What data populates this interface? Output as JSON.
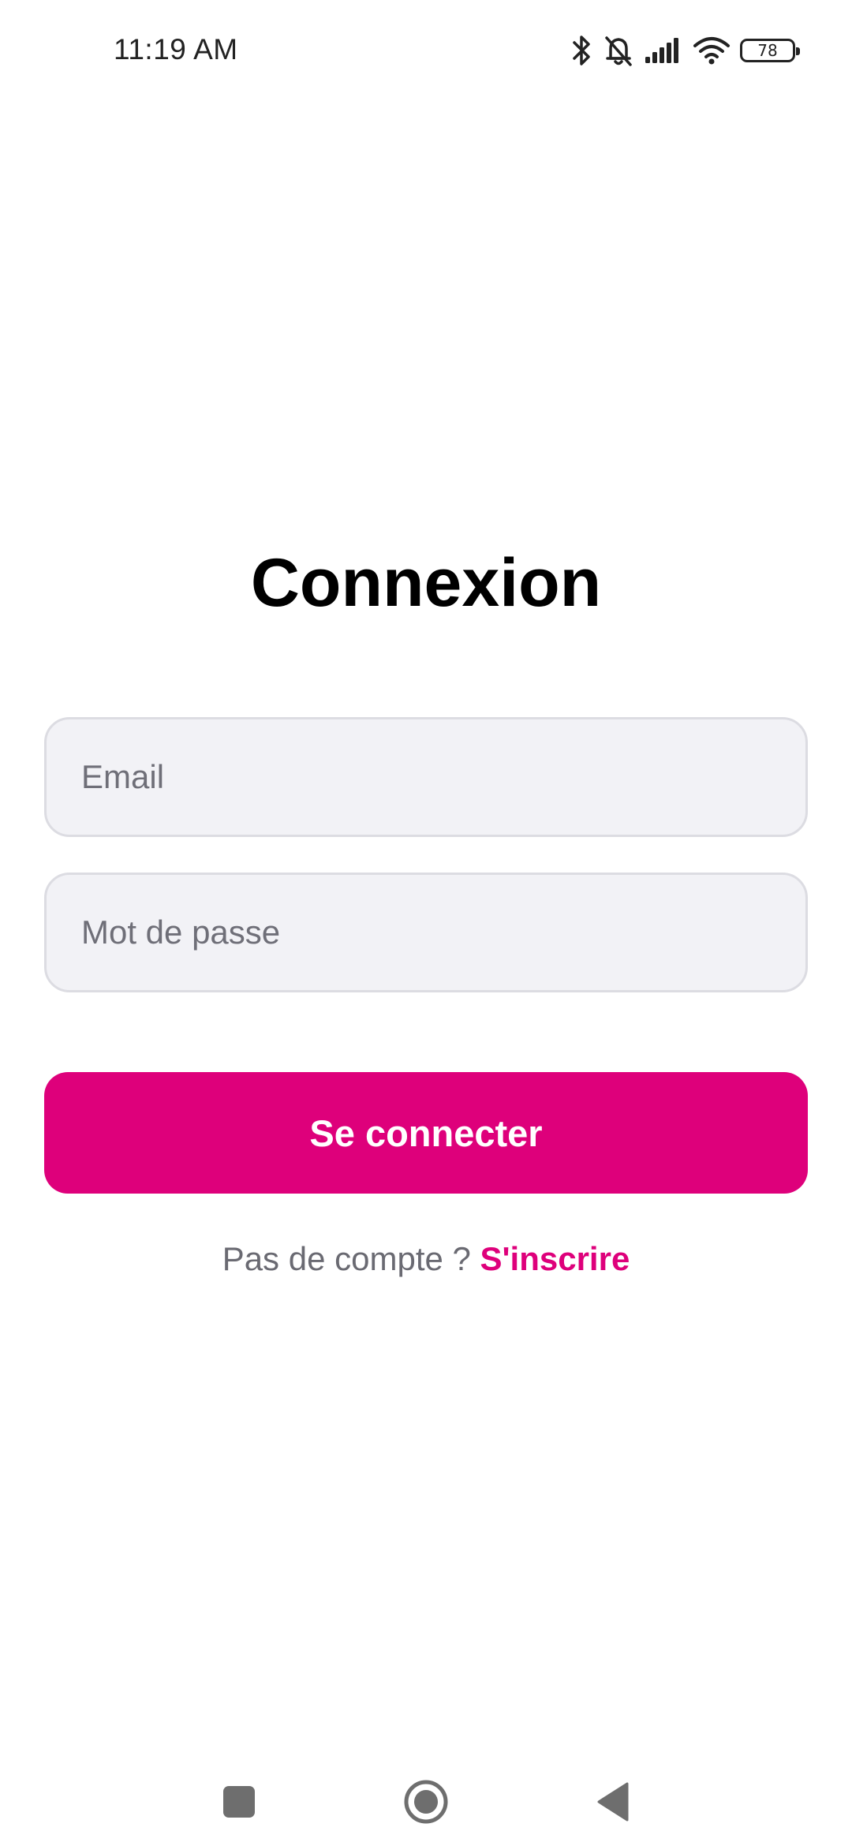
{
  "status_bar": {
    "time": "11:19 AM",
    "battery_level": "78",
    "icons": [
      "bluetooth-icon",
      "bell-off-icon",
      "signal-icon",
      "wifi-icon",
      "battery-icon"
    ]
  },
  "login": {
    "title": "Connexion",
    "email_placeholder": "Email",
    "email_value": "",
    "password_placeholder": "Mot de passe",
    "password_value": "",
    "submit_label": "Se connecter",
    "signup_prompt": "Pas de compte ? ",
    "signup_link": "S'inscrire"
  },
  "nav_bar": {
    "buttons": [
      "recents-icon",
      "home-icon",
      "back-icon"
    ]
  },
  "colors": {
    "accent": "#de007b",
    "field_background": "#f2f2f6",
    "field_border": "#dcdce2",
    "muted_text": "#6a6a72"
  }
}
